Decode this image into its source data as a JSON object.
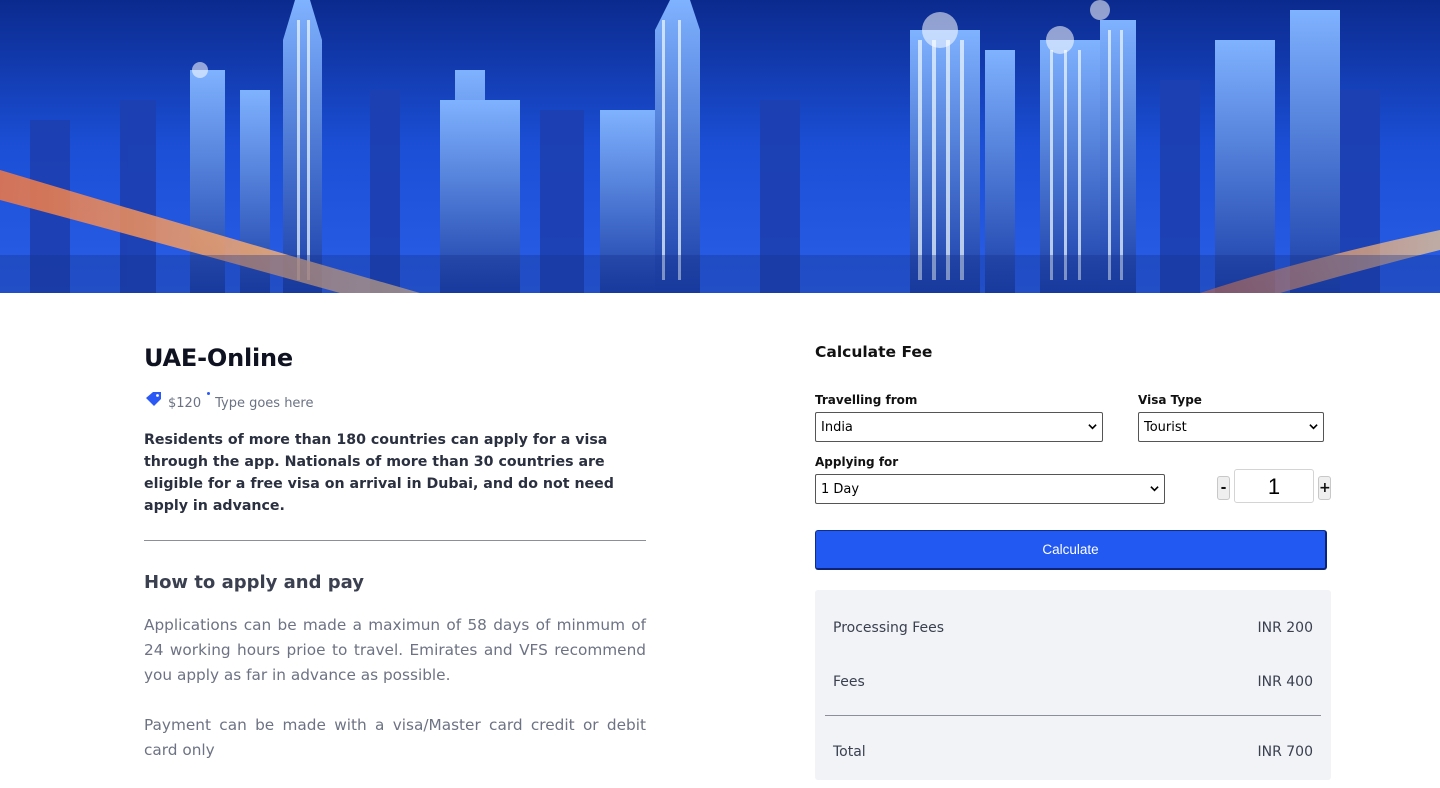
{
  "hero": {
    "alt": "Dubai city skyline at night"
  },
  "product": {
    "title": "UAE-Online",
    "price": "$120",
    "type_text": "Type goes here",
    "intro": "Residents of more than 180 countries can apply for a visa through the app. Nationals of more than 30 countries are eligible for a free visa on arrival in Dubai, and do not need apply in advance.",
    "how_title": "How to apply and pay",
    "paragraph1": "Applications can be made a maximun of 58 days of minmum of 24 working hours prioe to travel. Emirates and VFS recommend you apply as far in advance as possible.",
    "paragraph2": "Payment can be made with a visa/Master card credit or debit card only",
    "accent_color": "#2b59f5"
  },
  "calculator": {
    "title": "Calculate Fee",
    "travelling_from_label": "Travelling from",
    "travelling_from_value": "India",
    "visa_type_label": "Visa Type",
    "visa_type_value": "Tourist",
    "applying_for_label": "Applying for",
    "applying_for_value": "1 Day",
    "qty_minus": "-",
    "qty_value": "1",
    "qty_plus": "+",
    "calculate_label": "Calculate",
    "button_color": "#2259f3"
  },
  "summary": {
    "rows": [
      {
        "label": "Processing Fees",
        "value": "INR 200"
      },
      {
        "label": "Fees",
        "value": "INR 400"
      }
    ],
    "total_label": "Total",
    "total_value": "INR 700"
  }
}
